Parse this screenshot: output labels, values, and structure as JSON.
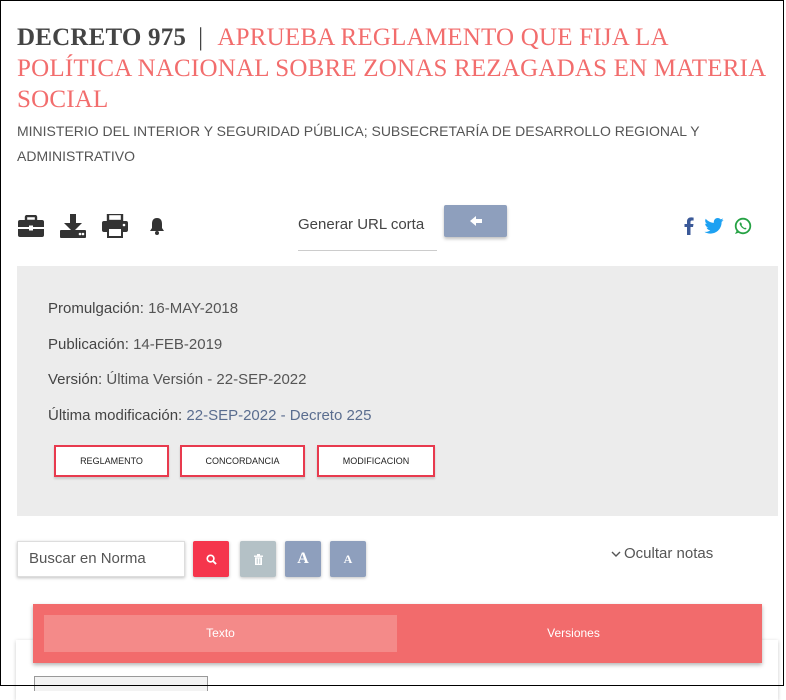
{
  "title": {
    "number": "DECRETO 975",
    "separator": "|",
    "name": "APRUEBA REGLAMENTO QUE FIJA LA POLÍTICA NACIONAL SOBRE ZONAS REZAGADAS EN MATERIA SOCIAL"
  },
  "ministry": "MINISTERIO DEL INTERIOR Y SEGURIDAD PÚBLICA; SUBSECRETARÍA DE DESARROLLO REGIONAL Y ADMINISTRATIVO",
  "toolbar": {
    "icons": [
      "briefcase-icon",
      "download-icon",
      "print-icon",
      "bell-icon"
    ],
    "url_label": "Generar URL corta",
    "url_button_icon": "arrow-left-icon"
  },
  "social": [
    "facebook-icon",
    "twitter-icon",
    "whatsapp-icon"
  ],
  "colors": {
    "accent": "#f26d6d",
    "button_red": "#e83a4e",
    "slate": "#8e9fbd",
    "gray_btn": "#b0bec5"
  },
  "info": {
    "promulgacion_label": "Promulgación:",
    "promulgacion_value": "16-MAY-2018",
    "publicacion_label": "Publicación:",
    "publicacion_value": "14-FEB-2019",
    "version_label": "Versión:",
    "version_value": "Última Versión - 22-SEP-2022",
    "modificacion_label": "Última modificación:",
    "modificacion_value": "22-SEP-2022 - Decreto 225",
    "buttons": [
      "REGLAMENTO",
      "CONCORDANCIA",
      "MODIFICACION"
    ]
  },
  "search": {
    "placeholder": "Buscar en Norma",
    "font_large": "A",
    "font_small": "A",
    "hide_notes": "Ocultar notas"
  },
  "tabs": [
    "Texto",
    "Versiones"
  ]
}
